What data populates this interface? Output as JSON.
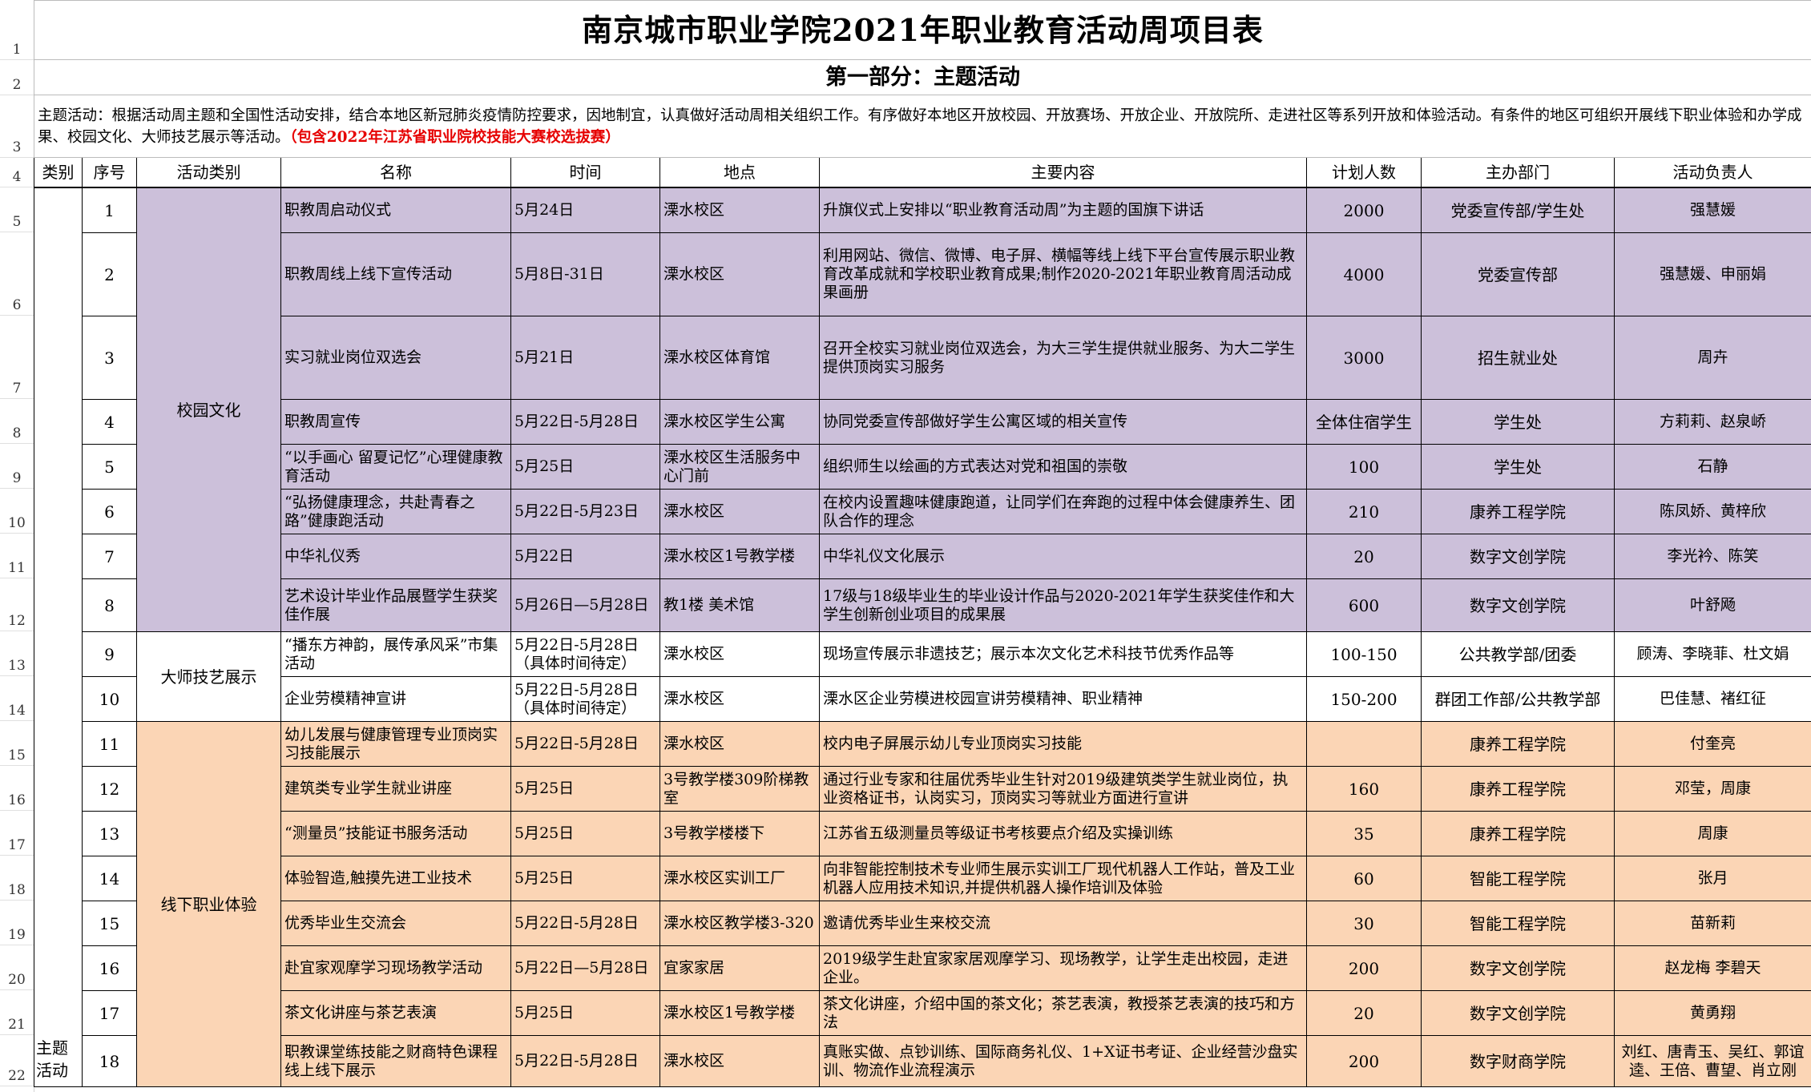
{
  "row_numbers": [
    "1",
    "2",
    "3",
    "4",
    "5",
    "6",
    "7",
    "8",
    "9",
    "10",
    "11",
    "12",
    "13",
    "14",
    "15",
    "16",
    "17",
    "18",
    "19",
    "20",
    "21",
    "22"
  ],
  "title": "南京城市职业学院2021年职业教育活动周项目表",
  "section_title": "第一部分：主题活动",
  "intro": {
    "text": "主题活动：根据活动周主题和全国性活动安排，结合本地区新冠肺炎疫情防控要求，因地制宜，认真做好活动周相关组织工作。有序做好本地区开放校园、开放赛场、开放企业、开放院所、走进社区等系列开放和体验活动。有条件的地区可组织开展线下职业体验和办学成果、校园文化、大师技艺展示等活动。",
    "highlight": "（包含2022年江苏省职业院校技能大赛校选拔赛）"
  },
  "headers": [
    "类别",
    "序号",
    "活动类别",
    "名称",
    "时间",
    "地点",
    "主要内容",
    "计划人数",
    "主办部门",
    "活动负责人"
  ],
  "category_main": "主题活动",
  "groups": {
    "campus": "校园文化",
    "master": "大师技艺展示",
    "offline": "线下职业体验"
  },
  "rows": [
    {
      "no": "1",
      "name": "职教周启动仪式",
      "time": "5月24日",
      "place": "溧水校区",
      "content": "升旗仪式上安排以“职业教育活动周”为主题的国旗下讲话",
      "count": "2000",
      "dept": "党委宣传部/学生处",
      "lead": "强慧媛"
    },
    {
      "no": "2",
      "name": "职教周线上线下宣传活动",
      "time": "5月8日-31日",
      "place": "溧水校区",
      "content": "利用网站、微信、微博、电子屏、横幅等线上线下平台宣传展示职业教育改革成就和学校职业教育成果;制作2020-2021年职业教育周活动成果画册",
      "count": "4000",
      "dept": "党委宣传部",
      "lead": "强慧媛、申丽娟"
    },
    {
      "no": "3",
      "name": "实习就业岗位双选会",
      "time": "5月21日",
      "place": "溧水校区体育馆",
      "content": "召开全校实习就业岗位双选会，为大三学生提供就业服务、为大二学生提供顶岗实习服务",
      "count": "3000",
      "dept": "招生就业处",
      "lead": "周卉"
    },
    {
      "no": "4",
      "name": "职教周宣传",
      "time": "5月22日-5月28日",
      "place": "溧水校区学生公寓",
      "content": "协同党委宣传部做好学生公寓区域的相关宣传",
      "count": "全体住宿学生",
      "dept": "学生处",
      "lead": "方莉莉、赵泉峤"
    },
    {
      "no": "5",
      "name": "“以手画心 留夏记忆”心理健康教育活动",
      "time": "5月25日",
      "place": "溧水校区生活服务中心门前",
      "content": "组织师生以绘画的方式表达对党和祖国的崇敬",
      "count": "100",
      "dept": "学生处",
      "lead": "石静"
    },
    {
      "no": "6",
      "name": "“弘扬健康理念，共赴青春之路”健康跑活动",
      "time": "5月22日-5月23日",
      "place": "溧水校区",
      "content": "在校内设置趣味健康跑道，让同学们在奔跑的过程中体会健康养生、团队合作的理念",
      "count": "210",
      "dept": "康养工程学院",
      "lead": "陈凤娇、黄梓欣"
    },
    {
      "no": "7",
      "name": "中华礼仪秀",
      "time": "5月22日",
      "place": "溧水校区1号教学楼",
      "content": "中华礼仪文化展示",
      "count": "20",
      "dept": "数字文创学院",
      "lead": "李光衿、陈笑"
    },
    {
      "no": "8",
      "name": "艺术设计毕业作品展暨学生获奖佳作展",
      "time": "5月26日—5月28日",
      "place": "教1楼  美术馆",
      "content": "17级与18级毕业生的毕业设计作品与2020-2021年学生获奖佳作和大学生创新创业项目的成果展",
      "count": "600",
      "dept": "数字文创学院",
      "lead": "叶舒飏"
    },
    {
      "no": "9",
      "name": "“播东方神韵，展传承风采”市集活动",
      "time": "5月22日-5月28日（具体时间待定）",
      "place": "溧水校区",
      "content": "现场宣传展示非遗技艺；展示本次文化艺术科技节优秀作品等",
      "count": "100-150",
      "dept": "公共教学部/团委",
      "lead": "顾涛、李晓菲、杜文娟"
    },
    {
      "no": "10",
      "name": "企业劳模精神宣讲",
      "time": "5月22日-5月28日（具体时间待定）",
      "place": "溧水校区",
      "content": "溧水区企业劳模进校园宣讲劳模精神、职业精神",
      "count": "150-200",
      "dept": "群团工作部/公共教学部",
      "lead": "巴佳慧、褚红征"
    },
    {
      "no": "11",
      "name": "幼儿发展与健康管理专业顶岗实习技能展示",
      "time": "5月22日-5月28日",
      "place": "溧水校区",
      "content": "校内电子屏展示幼儿专业顶岗实习技能",
      "count": "",
      "dept": "康养工程学院",
      "lead": "付奎亮"
    },
    {
      "no": "12",
      "name": "建筑类专业学生就业讲座",
      "time": "5月25日",
      "place": "3号教学楼309阶梯教室",
      "content": "通过行业专家和往届优秀毕业生针对2019级建筑类学生就业岗位，执业资格证书，认岗实习，顶岗实习等就业方面进行宣讲",
      "count": "160",
      "dept": "康养工程学院",
      "lead": "邓莹，周康"
    },
    {
      "no": "13",
      "name": "“测量员”技能证书服务活动",
      "time": "5月25日",
      "place": "3号教学楼楼下",
      "content": "江苏省五级测量员等级证书考核要点介绍及实操训练",
      "count": "35",
      "dept": "康养工程学院",
      "lead": "周康"
    },
    {
      "no": "14",
      "name": "体验智造,触摸先进工业技术",
      "time": "5月25日",
      "place": "溧水校区实训工厂",
      "content": "向非智能控制技术专业师生展示实训工厂现代机器人工作站，普及工业机器人应用技术知识,并提供机器人操作培训及体验",
      "count": "60",
      "dept": "智能工程学院",
      "lead": "张月"
    },
    {
      "no": "15",
      "name": "优秀毕业生交流会",
      "time": "5月22日-5月28日",
      "place": "溧水校区教学楼3-320",
      "content": "邀请优秀毕业生来校交流",
      "count": "30",
      "dept": "智能工程学院",
      "lead": "苗新莉"
    },
    {
      "no": "16",
      "name": "赴宜家观摩学习现场教学活动",
      "time": "5月22日—5月28日",
      "place": "宜家家居",
      "content": "2019级学生赴宜家家居观摩学习、现场教学，让学生走出校园，走进企业。",
      "count": "200",
      "dept": "数字文创学院",
      "lead": "赵龙梅  李碧天"
    },
    {
      "no": "17",
      "name": "茶文化讲座与茶艺表演",
      "time": "5月25日",
      "place": "溧水校区1号教学楼",
      "content": "茶文化讲座，介绍中国的茶文化；茶艺表演，教授茶艺表演的技巧和方法",
      "count": "20",
      "dept": "数字文创学院",
      "lead": "黄勇翔"
    },
    {
      "no": "18",
      "name": "职教课堂练技能之财商特色课程线上线下展示",
      "time": "5月22日-5月28日",
      "place": "溧水校区",
      "content": "真账实做、点钞训练、国际商务礼仪、1+X证书考证、企业经营沙盘实训、物流作业流程演示",
      "count": "200",
      "dept": "数字财商学院",
      "lead": "刘红、唐青玉、吴红、郭谊逵、王倍、曹望、肖立刚"
    }
  ]
}
